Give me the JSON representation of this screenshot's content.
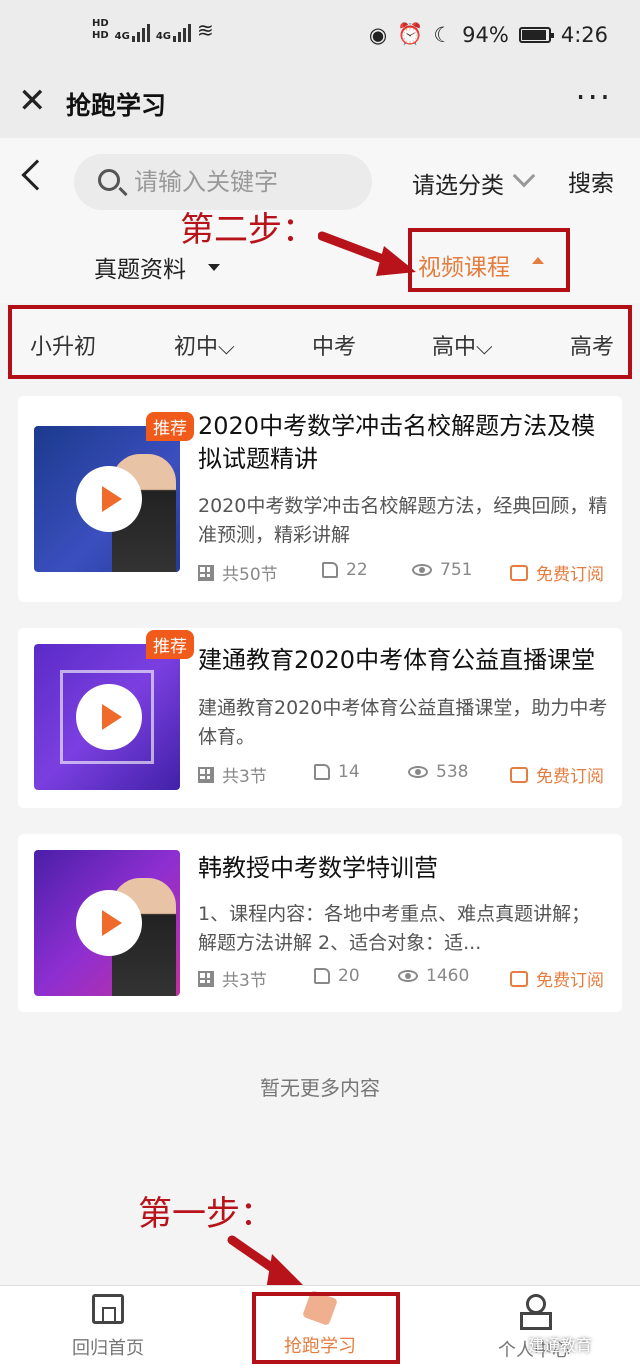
{
  "status_bar": {
    "hd1": "HD",
    "hd2": "HD",
    "net1": "4G",
    "net2": "4G",
    "battery": "94%",
    "battery_level": 0.94,
    "time": "4:26"
  },
  "title_bar": {
    "title": "抢跑学习",
    "more": "···"
  },
  "search": {
    "placeholder": "请输入关键字",
    "category_label": "请选分类",
    "search_button": "搜索"
  },
  "filters": {
    "left_label": "真题资料",
    "active_label": "视频课程"
  },
  "annotations": {
    "step2": "第二步：",
    "step1": "第一步："
  },
  "grade_tabs": [
    "小升初",
    "初中⌵",
    "中考",
    "高中⌵",
    "高考"
  ],
  "courses": [
    {
      "badge": "推荐",
      "title": "2020中考数学冲击名校解题方法及模拟试题精讲",
      "desc": "2020中考数学冲击名校解题方法，经典回顾，精准预测，精彩讲解",
      "lessons": "共50节",
      "likes": "22",
      "views": "751",
      "subscribe": "免费订阅"
    },
    {
      "badge": "推荐",
      "title": "建通教育2020中考体育公益直播课堂",
      "desc": "建通教育2020中考体育公益直播课堂，助力中考体育。",
      "lessons": "共3节",
      "likes": "14",
      "views": "538",
      "subscribe": "免费订阅"
    },
    {
      "badge": "",
      "title": "韩教授中考数学特训营",
      "desc": "1、课程内容：各地中考重点、难点真题讲解；解题方法讲解 2、适合对象：适...",
      "lessons": "共3节",
      "likes": "20",
      "views": "1460",
      "subscribe": "免费订阅"
    }
  ],
  "no_more": "暂无更多内容",
  "bottom_nav": {
    "home": "回归首页",
    "study": "抢跑学习",
    "profile": "个人中心"
  },
  "watermark": "建通教育",
  "colors": {
    "accent": "#e57d3f",
    "annotation_red": "#b20f16",
    "badge": "#f05a1a"
  }
}
